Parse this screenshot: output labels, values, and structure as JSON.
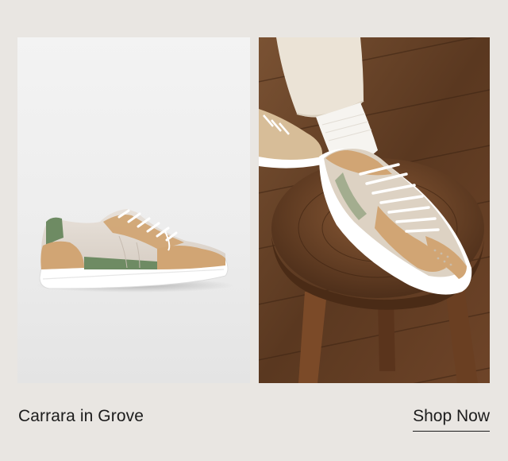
{
  "product": {
    "name": "Carrara in Grove"
  },
  "cta": {
    "label": "Shop Now"
  },
  "images": {
    "left": "sneaker-product-image",
    "right": "sneaker-lifestyle-image"
  },
  "colors": {
    "background": "#e9e6e2",
    "text": "#1c1c1c",
    "suede_tan": "#d1a574",
    "grove_green": "#6e8b63",
    "sole_white": "#ffffff",
    "wood_brown": "#6b4328"
  }
}
